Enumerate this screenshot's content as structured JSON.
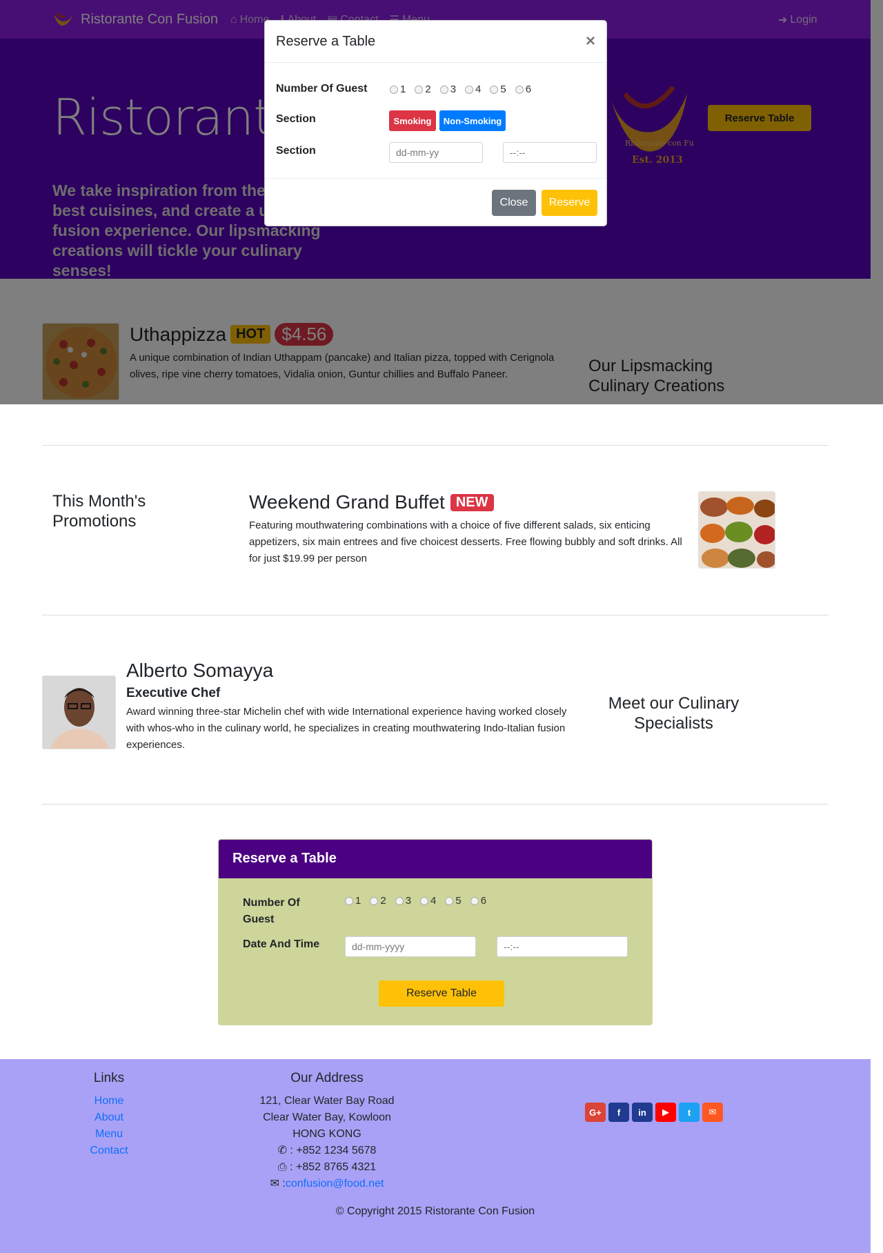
{
  "navbar": {
    "brand": "Ristorante Con Fusion",
    "links": [
      {
        "label": "Home",
        "icon": "home-icon"
      },
      {
        "label": "About",
        "icon": "info-icon"
      },
      {
        "label": "Contact",
        "icon": "address-card-icon"
      },
      {
        "label": "Menu",
        "icon": "list-icon"
      }
    ],
    "login": "Login",
    "color": "#8e1ee6"
  },
  "jumbotron": {
    "title": "Ristorante con Fusion",
    "text": "We take inspiration from the World's best cuisines, and create a unique fusion experience. Our lipsmacking creations will tickle your culinary senses!",
    "logo_text": "Ristorante con Fusion",
    "logo_est": "Est. 2013",
    "button": "Reserve Table",
    "color": "#5a03bf"
  },
  "dish": {
    "name": "Uthappizza",
    "badge": "HOT",
    "price": "$4.56",
    "description": "A unique combination of Indian Uthappam (pancake) and Italian pizza, topped with Cerignola olives, ripe vine cherry tomatoes, Vidalia onion, Guntur chillies and Buffalo Paneer.",
    "side_heading": "Our Lipsmacking Culinary Creations"
  },
  "promotion": {
    "side_heading": "This Month's Promotions",
    "name": "Weekend Grand Buffet",
    "badge": "NEW",
    "description": "Featuring mouthwatering combinations with a choice of five different salads, six enticing appetizers, six main entrees and five choicest desserts. Free flowing bubbly and soft drinks. All for just $19.99 per person"
  },
  "leader": {
    "name": "Alberto Somayya",
    "designation": "Executive Chef",
    "description": "Award winning three-star Michelin chef with wide International experience having worked closely with whos-who in the culinary world, he specializes in creating mouthwatering Indo-Italian fusion experiences.",
    "side_heading": "Meet our Culinary Specialists"
  },
  "reserve_card": {
    "header": "Reserve a Table",
    "guests_label": "Number Of Guest",
    "guests": [
      "1",
      "2",
      "3",
      "4",
      "5",
      "6"
    ],
    "datetime_label": "Date And Time",
    "date_placeholder": "dd-mm-yyyy",
    "time_placeholder": "--:--",
    "button": "Reserve Table",
    "header_color": "#4b0082",
    "body_color": "#cdd59a"
  },
  "footer": {
    "links_heading": "Links",
    "links": [
      "Home",
      "About",
      "Menu",
      "Contact"
    ],
    "address_heading": "Our Address",
    "address_lines": [
      "121, Clear Water Bay Road",
      "Clear Water Bay, Kowloon",
      "HONG KONG"
    ],
    "phone": ": +852 1234 5678",
    "fax": ": +852 8765 4321",
    "email_prefix": ":",
    "email": "confusion@food.net",
    "social": [
      {
        "icon": "google-plus-icon",
        "color": "#db4437"
      },
      {
        "icon": "facebook-icon",
        "color": "#1f3b8f"
      },
      {
        "icon": "linkedin-icon",
        "color": "#1f3b8f"
      },
      {
        "icon": "youtube-icon",
        "color": "#ff0000"
      },
      {
        "icon": "twitter-icon",
        "color": "#1da1f2"
      },
      {
        "icon": "envelope-icon",
        "color": "#ff5722"
      }
    ],
    "copyright": "© Copyright 2015 Ristorante Con Fusion",
    "color": "#a9a1f5"
  },
  "modal": {
    "title": "Reserve a Table",
    "close_symbol": "×",
    "guests_label": "Number Of Guest",
    "guests": [
      "1",
      "2",
      "3",
      "4",
      "5",
      "6"
    ],
    "section_label": "Section",
    "section_options": [
      {
        "label": "Smoking",
        "color": "#dc3545"
      },
      {
        "label": "Non-Smoking",
        "color": "#007bff"
      }
    ],
    "datetime_label": "Section",
    "date_placeholder": "dd-mm-yy",
    "time_placeholder": "--:--",
    "close_button": "Close",
    "reserve_button": "Reserve"
  }
}
